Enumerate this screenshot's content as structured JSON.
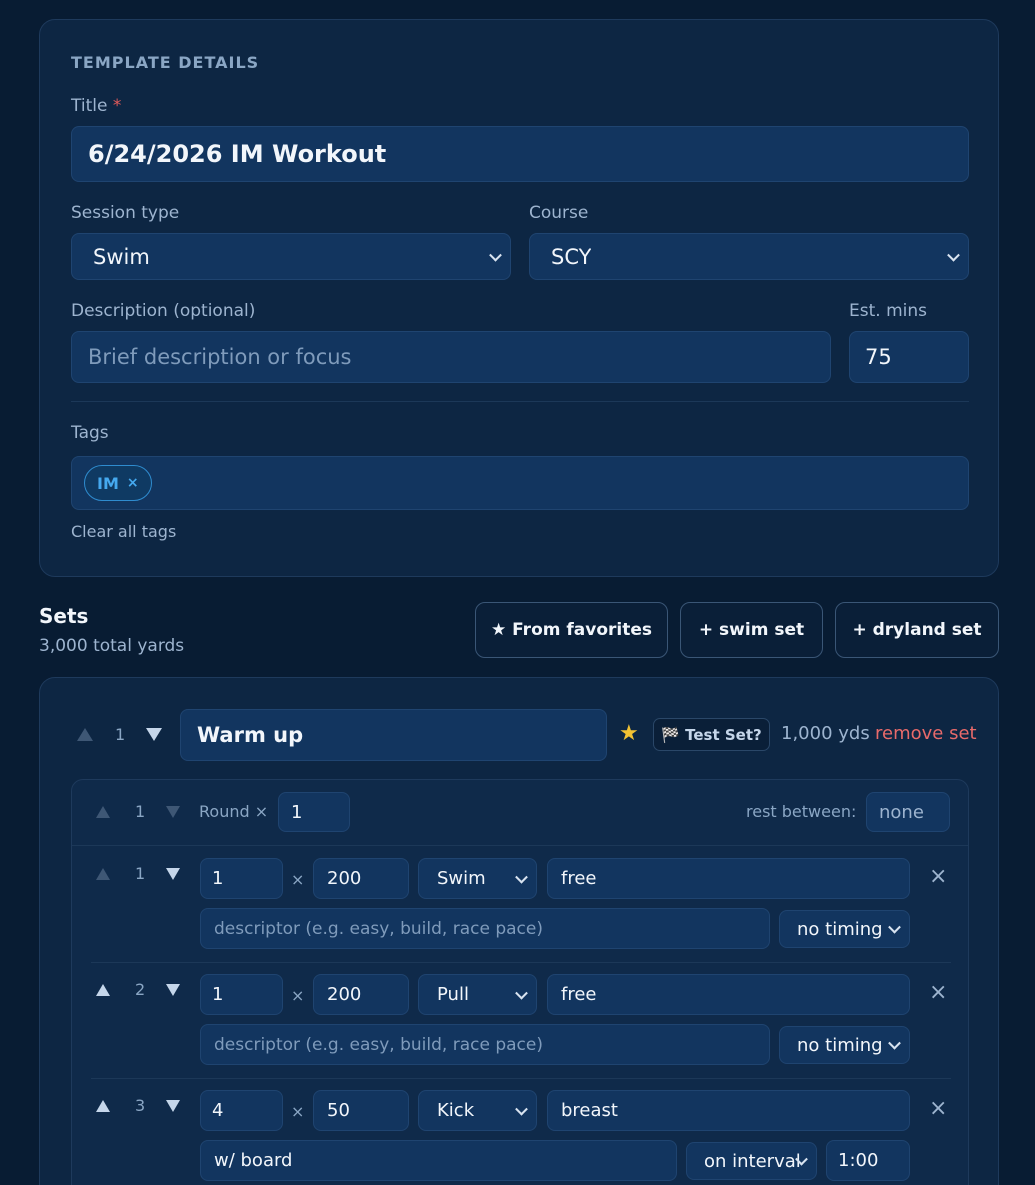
{
  "template": {
    "section_label": "TEMPLATE DETAILS",
    "title_label": "Title",
    "title_required_marker": "*",
    "title_value": "6/24/2026 IM Workout",
    "session_type_label": "Session type",
    "session_type_value": "Swim",
    "course_label": "Course",
    "course_value": "SCY",
    "description_label": "Description (optional)",
    "description_placeholder": "Brief description or focus",
    "est_mins_label": "Est. mins",
    "est_mins_value": "75",
    "tags_label": "Tags",
    "tags": [
      {
        "label": "IM",
        "remove": "×"
      }
    ],
    "clear_tags": "Clear all tags"
  },
  "sets_header": {
    "title": "Sets",
    "total": "3,000 total yards",
    "from_favorites": "★ From favorites",
    "add_swim": "+ swim set",
    "add_dryland": "+ dryland set"
  },
  "set": {
    "index": "1",
    "name": "Warm up",
    "star": "★",
    "test_set": "🏁 Test Set?",
    "yards": "1,000 yds",
    "remove": "remove set",
    "round": {
      "index": "1",
      "label": "Round ×",
      "value": "1",
      "rest_label": "rest between:",
      "rest_value": "none"
    },
    "items": [
      {
        "index": "1",
        "reps": "1",
        "times": "×",
        "distance": "200",
        "stroke_type": "Swim",
        "stroke": "free",
        "descriptor": "",
        "descriptor_placeholder": "descriptor (e.g. easy, build, race pace)",
        "timing": "no timing",
        "interval": "",
        "remove": "×"
      },
      {
        "index": "2",
        "reps": "1",
        "times": "×",
        "distance": "200",
        "stroke_type": "Pull",
        "stroke": "free",
        "descriptor": "",
        "descriptor_placeholder": "descriptor (e.g. easy, build, race pace)",
        "timing": "no timing",
        "interval": "",
        "remove": "×"
      },
      {
        "index": "3",
        "reps": "4",
        "times": "×",
        "distance": "50",
        "stroke_type": "Kick",
        "stroke": "breast",
        "descriptor": "w/ board",
        "descriptor_placeholder": "",
        "timing": "on interval",
        "interval": "1:00",
        "remove": "×"
      }
    ]
  },
  "colors": {
    "background": "#081c33",
    "card": "#0d2643",
    "input": "#12355f",
    "accent_tag": "#45a9ef",
    "danger": "#e86a6a",
    "star": "#f2c233"
  }
}
